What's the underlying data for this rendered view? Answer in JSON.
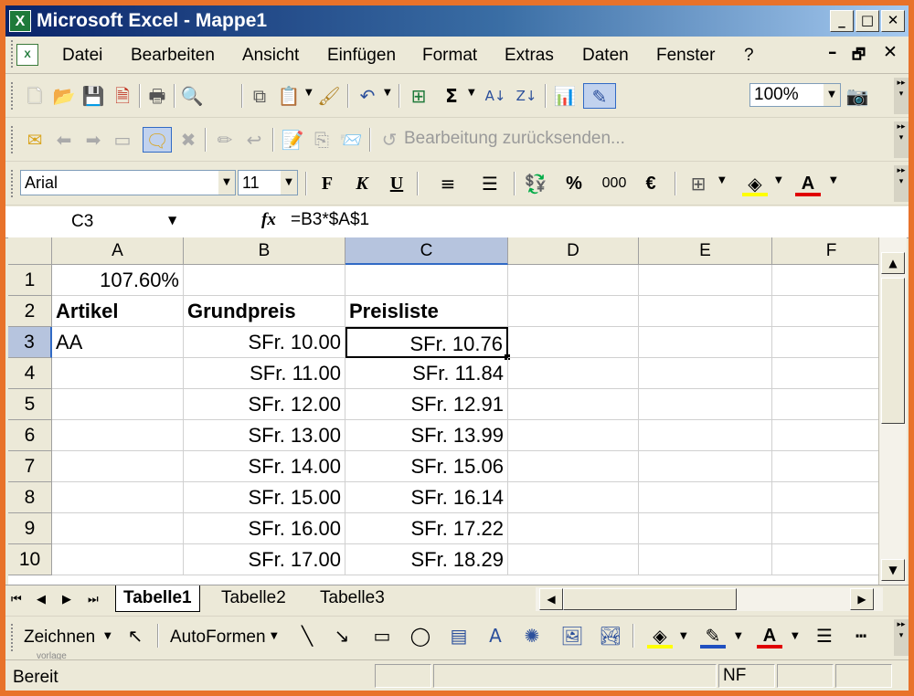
{
  "window": {
    "title": "Microsoft Excel - Mappe1",
    "app_icon": "X",
    "controls": [
      "_",
      "□",
      "✕"
    ]
  },
  "menu": {
    "items": [
      "Datei",
      "Bearbeiten",
      "Ansicht",
      "Einfügen",
      "Format",
      "Extras",
      "Daten",
      "Fenster",
      "?"
    ],
    "doc_controls": [
      "–",
      "🗗",
      "✕"
    ]
  },
  "standard_toolbar": {
    "zoom": "100%"
  },
  "review_toolbar": {
    "send_back_label": "Bearbeitung zurücksenden..."
  },
  "format_toolbar": {
    "font": "Arial",
    "size": "11",
    "bold": "F",
    "italic": "K",
    "underline": "U",
    "percent": "%",
    "thousands": "000",
    "euro": "€"
  },
  "formula_bar": {
    "name_box": "C3",
    "fx": "fx",
    "formula": "=B3*$A$1"
  },
  "grid": {
    "columns": [
      "A",
      "B",
      "C",
      "D",
      "E",
      "F"
    ],
    "rows": [
      "1",
      "2",
      "3",
      "4",
      "5",
      "6",
      "7",
      "8",
      "9",
      "10"
    ],
    "cells": [
      [
        "107.60%",
        "",
        "",
        "",
        "",
        ""
      ],
      [
        "Artikel",
        "Grundpreis",
        "Preisliste",
        "",
        "",
        ""
      ],
      [
        "AA",
        "SFr. 10.00",
        "SFr. 10.76",
        "",
        "",
        ""
      ],
      [
        "",
        "SFr. 11.00",
        "SFr. 11.84",
        "",
        "",
        ""
      ],
      [
        "",
        "SFr. 12.00",
        "SFr. 12.91",
        "",
        "",
        ""
      ],
      [
        "",
        "SFr. 13.00",
        "SFr. 13.99",
        "",
        "",
        ""
      ],
      [
        "",
        "SFr. 14.00",
        "SFr. 15.06",
        "",
        "",
        ""
      ],
      [
        "",
        "SFr. 15.00",
        "SFr. 16.14",
        "",
        "",
        ""
      ],
      [
        "",
        "SFr. 16.00",
        "SFr. 17.22",
        "",
        "",
        ""
      ],
      [
        "",
        "SFr. 17.00",
        "SFr. 18.29",
        "",
        "",
        ""
      ]
    ],
    "active_cell": "C3"
  },
  "sheets": {
    "tabs": [
      "Tabelle1",
      "Tabelle2",
      "Tabelle3"
    ],
    "active": "Tabelle1"
  },
  "drawing_toolbar": {
    "draw_label": "Zeichnen",
    "autoshapes_label": "AutoFormen",
    "watermark": "vorlage"
  },
  "status": {
    "text": "Bereit",
    "mode": "NF"
  }
}
